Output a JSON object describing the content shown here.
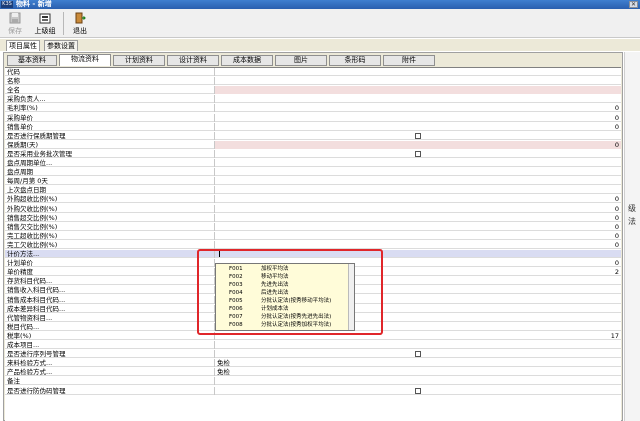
{
  "window": {
    "logo": "K3S",
    "title": "物料 - 新增",
    "close": "✕"
  },
  "toolbar": {
    "save_label": "保存",
    "parent_label": "上级组",
    "exit_label": "退出"
  },
  "prop_tabs": [
    "项目属性",
    "参数设置"
  ],
  "tabs": [
    "基本资料",
    "物流资料",
    "计划资料",
    "设计资料",
    "成本数据",
    "图片",
    "条形码",
    "附件"
  ],
  "rows": [
    {
      "label": "代码",
      "value": "",
      "num": "",
      "check": false,
      "pink": false
    },
    {
      "label": "名称",
      "value": "",
      "num": "",
      "check": false,
      "pink": false
    },
    {
      "label": "全名",
      "value": "",
      "num": "",
      "check": false,
      "pink": true
    },
    {
      "label": "采购负责人...",
      "value": "",
      "num": "",
      "check": false,
      "pink": false
    },
    {
      "label": "毛利率(%)",
      "value": "",
      "num": "0",
      "check": false,
      "pink": false
    },
    {
      "label": "采购单价",
      "value": "",
      "num": "0",
      "check": false,
      "pink": false
    },
    {
      "label": "销售单价",
      "value": "",
      "num": "0",
      "check": false,
      "pink": false
    },
    {
      "label": "是否进行保质期管理",
      "value": "",
      "num": "",
      "check": true,
      "pink": false
    },
    {
      "label": "保质期(天)",
      "value": "",
      "num": "0",
      "check": false,
      "pink": true
    },
    {
      "label": "是否采用业务批次管理",
      "value": "",
      "num": "",
      "check": true,
      "pink": false
    },
    {
      "label": "盘点周期单位...",
      "value": "",
      "num": "",
      "check": false,
      "pink": false
    },
    {
      "label": "盘点周期",
      "value": "",
      "num": "",
      "check": false,
      "pink": false
    },
    {
      "label": "每周/月第 0天",
      "value": "",
      "num": "",
      "check": false,
      "pink": false
    },
    {
      "label": "上次盘点日期",
      "value": "",
      "num": "",
      "check": false,
      "pink": false
    },
    {
      "label": "外购超收比例(%)",
      "value": "",
      "num": "0",
      "check": false,
      "pink": false
    },
    {
      "label": "外购欠收比例(%)",
      "value": "",
      "num": "0",
      "check": false,
      "pink": false
    },
    {
      "label": "销售超交比例(%)",
      "value": "",
      "num": "0",
      "check": false,
      "pink": false
    },
    {
      "label": "销售欠交比例(%)",
      "value": "",
      "num": "0",
      "check": false,
      "pink": false
    },
    {
      "label": "完工超收比例(%)",
      "value": "",
      "num": "0",
      "check": false,
      "pink": false
    },
    {
      "label": "完工欠收比例(%)",
      "value": "",
      "num": "0",
      "check": false,
      "pink": false
    },
    {
      "label": "计价方法...",
      "value": "",
      "num": "",
      "check": false,
      "pink": false,
      "selected": true
    },
    {
      "label": "计划单价",
      "value": "",
      "num": "0",
      "check": false,
      "pink": false
    },
    {
      "label": "单价精度",
      "value": "",
      "num": "2",
      "check": false,
      "pink": false
    },
    {
      "label": "存货科目代码...",
      "value": "",
      "num": "",
      "check": false,
      "pink": false
    },
    {
      "label": "销售收入科目代码...",
      "value": "",
      "num": "",
      "check": false,
      "pink": false
    },
    {
      "label": "销售成本科目代码...",
      "value": "",
      "num": "",
      "check": false,
      "pink": false
    },
    {
      "label": "成本差异科目代码...",
      "value": "",
      "num": "",
      "check": false,
      "pink": false
    },
    {
      "label": "代管物资科目...",
      "value": "",
      "num": "",
      "check": false,
      "pink": false
    },
    {
      "label": "税目代码...",
      "value": "",
      "num": "",
      "check": false,
      "pink": false
    },
    {
      "label": "税率(%)",
      "value": "",
      "num": "17",
      "check": false,
      "pink": false
    },
    {
      "label": "成本项目...",
      "value": "",
      "num": "",
      "check": false,
      "pink": false
    },
    {
      "label": "是否进行序列号管理",
      "value": "",
      "num": "",
      "check": true,
      "pink": false
    },
    {
      "label": "来料检验方式...",
      "value": "免检",
      "num": "",
      "check": false,
      "pink": false
    },
    {
      "label": "产品检验方式...",
      "value": "免检",
      "num": "",
      "check": false,
      "pink": false
    },
    {
      "label": "备注",
      "value": "",
      "num": "",
      "check": false,
      "pink": false
    },
    {
      "label": "是否进行防伪码管理",
      "value": "",
      "num": "",
      "check": true,
      "pink": false
    }
  ],
  "dropdown": [
    {
      "code": "F001",
      "name": "加权平均法"
    },
    {
      "code": "F002",
      "name": "移动平均法"
    },
    {
      "code": "F003",
      "name": "先进先出法"
    },
    {
      "code": "F004",
      "name": "后进先出法"
    },
    {
      "code": "F005",
      "name": "分批认定法(按秀移动平均法)"
    },
    {
      "code": "F006",
      "name": "计划成本法"
    },
    {
      "code": "F007",
      "name": "分批认定法(按秀先进先出法)"
    },
    {
      "code": "F008",
      "name": "分批认定法(按秀加权平均法)"
    }
  ],
  "side_glyphs": [
    "级",
    "法"
  ]
}
